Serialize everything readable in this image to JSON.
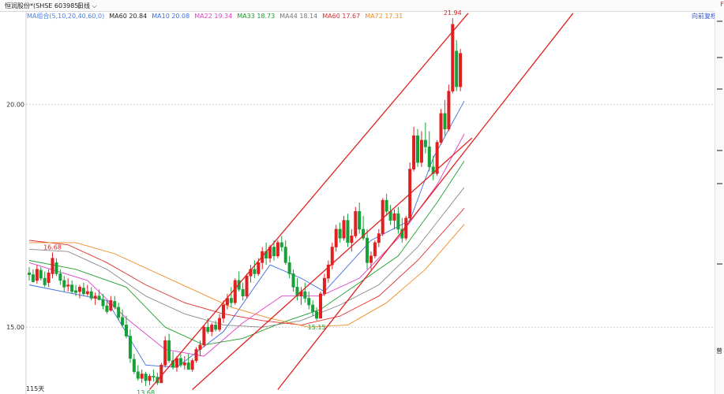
{
  "header": {
    "stock_title": "恒润股份*(SHSE 603985)",
    "period": "日线",
    "adjust": "向前复权",
    "marker": "F"
  },
  "ma_legend": [
    {
      "label": "MA组合(5,10,20,40,60,0)",
      "color": "#4a7de0"
    },
    {
      "label": "MA60 20.84",
      "color": "#222222"
    },
    {
      "label": "MA10 20.08",
      "color": "#3a6fe0"
    },
    {
      "label": "MA22 19.34",
      "color": "#e040c8"
    },
    {
      "label": "MA33 18.73",
      "color": "#20a030"
    },
    {
      "label": "MA44 18.14",
      "color": "#777777"
    },
    {
      "label": "MA60 17.67",
      "color": "#e03030"
    },
    {
      "label": "MA72 17.31",
      "color": "#f08a20"
    }
  ],
  "footer": {
    "days_label": "115天",
    "rail_button": "曾"
  },
  "chart_data": {
    "type": "candlestick",
    "ylim": [
      13.5,
      22.1
    ],
    "y_ticks": [
      15.0,
      20.0
    ],
    "y_tick_labels": [
      "15.00",
      "20.00"
    ],
    "grid": true,
    "up_color": "#e02020",
    "down_color": "#17a037",
    "annotations": [
      {
        "label": "21.94",
        "index": 109,
        "value": 21.94
      },
      {
        "label": "16.68",
        "index": 6,
        "value": 16.68
      },
      {
        "label": "13.68",
        "index": 30,
        "value": 13.68
      },
      {
        "label": "15.15",
        "index": 74,
        "value": 15.15
      }
    ],
    "trend_channel": {
      "color": "#e02020",
      "upper": {
        "start": [
          31,
          13.6
        ],
        "end": [
          113,
          22.05
        ]
      },
      "lower": {
        "start": [
          64,
          13.6
        ],
        "end": [
          140,
          22.05
        ]
      },
      "mid": {
        "start": [
          42,
          13.6
        ],
        "end": [
          114,
          19.25
        ]
      }
    },
    "ohlc": [
      [
        16.22,
        16.35,
        16.05,
        16.18
      ],
      [
        16.18,
        16.3,
        16.0,
        16.02
      ],
      [
        16.05,
        16.4,
        15.98,
        16.3
      ],
      [
        16.28,
        16.35,
        16.05,
        16.1
      ],
      [
        16.1,
        16.25,
        15.9,
        15.95
      ],
      [
        16.0,
        16.3,
        15.9,
        16.22
      ],
      [
        16.2,
        16.68,
        16.1,
        16.55
      ],
      [
        16.45,
        16.55,
        16.15,
        16.2
      ],
      [
        16.2,
        16.3,
        15.95,
        16.05
      ],
      [
        16.05,
        16.15,
        15.8,
        15.9
      ],
      [
        15.92,
        16.1,
        15.8,
        15.95
      ],
      [
        15.95,
        16.05,
        15.75,
        15.8
      ],
      [
        15.82,
        15.95,
        15.7,
        15.78
      ],
      [
        15.8,
        15.95,
        15.65,
        15.9
      ],
      [
        15.88,
        16.0,
        15.7,
        15.75
      ],
      [
        15.75,
        15.95,
        15.7,
        15.8
      ],
      [
        15.8,
        15.9,
        15.6,
        15.65
      ],
      [
        15.65,
        15.78,
        15.5,
        15.7
      ],
      [
        15.7,
        15.85,
        15.6,
        15.62
      ],
      [
        15.62,
        15.75,
        15.4,
        15.48
      ],
      [
        15.48,
        15.6,
        15.3,
        15.35
      ],
      [
        15.38,
        15.7,
        15.35,
        15.6
      ],
      [
        15.58,
        15.7,
        15.4,
        15.45
      ],
      [
        15.45,
        15.55,
        15.15,
        15.22
      ],
      [
        15.22,
        15.4,
        15.0,
        15.05
      ],
      [
        15.05,
        15.25,
        14.75,
        14.8
      ],
      [
        14.8,
        14.95,
        14.2,
        14.3
      ],
      [
        14.28,
        14.4,
        13.95,
        14.0
      ],
      [
        14.0,
        14.15,
        13.8,
        13.85
      ],
      [
        13.85,
        14.05,
        13.75,
        13.95
      ],
      [
        13.95,
        14.0,
        13.68,
        13.8
      ],
      [
        13.8,
        13.95,
        13.7,
        13.9
      ],
      [
        13.9,
        14.05,
        13.78,
        13.88
      ],
      [
        13.88,
        13.98,
        13.7,
        13.75
      ],
      [
        13.75,
        14.2,
        13.75,
        14.15
      ],
      [
        14.15,
        14.8,
        14.1,
        14.7
      ],
      [
        14.7,
        14.85,
        14.2,
        14.25
      ],
      [
        14.25,
        14.45,
        14.05,
        14.1
      ],
      [
        14.1,
        14.35,
        14.0,
        14.3
      ],
      [
        14.3,
        14.4,
        14.1,
        14.15
      ],
      [
        14.15,
        14.35,
        14.05,
        14.2
      ],
      [
        14.2,
        14.4,
        14.1,
        14.05
      ],
      [
        14.05,
        14.3,
        14.0,
        14.25
      ],
      [
        14.25,
        14.55,
        14.2,
        14.5
      ],
      [
        14.5,
        14.7,
        14.35,
        14.6
      ],
      [
        14.6,
        15.05,
        14.55,
        15.0
      ],
      [
        15.0,
        15.2,
        14.85,
        14.9
      ],
      [
        14.9,
        15.1,
        14.8,
        15.05
      ],
      [
        15.05,
        15.15,
        14.9,
        14.95
      ],
      [
        14.95,
        15.3,
        14.9,
        15.2
      ],
      [
        15.2,
        15.6,
        15.1,
        15.5
      ],
      [
        15.5,
        15.75,
        15.4,
        15.65
      ],
      [
        15.65,
        15.9,
        15.45,
        15.55
      ],
      [
        15.55,
        16.1,
        15.5,
        16.05
      ],
      [
        16.05,
        16.25,
        15.8,
        15.85
      ],
      [
        15.85,
        16.0,
        15.6,
        15.7
      ],
      [
        15.7,
        16.2,
        15.65,
        16.15
      ],
      [
        16.15,
        16.4,
        16.0,
        16.3
      ],
      [
        16.3,
        16.5,
        16.1,
        16.2
      ],
      [
        16.2,
        16.55,
        16.15,
        16.45
      ],
      [
        16.45,
        16.8,
        16.3,
        16.7
      ],
      [
        16.7,
        16.9,
        16.4,
        16.55
      ],
      [
        16.55,
        16.85,
        16.45,
        16.8
      ],
      [
        16.8,
        16.95,
        16.5,
        16.6
      ],
      [
        16.6,
        16.95,
        16.55,
        16.9
      ],
      [
        16.9,
        17.05,
        16.7,
        16.8
      ],
      [
        16.8,
        16.95,
        16.4,
        16.45
      ],
      [
        16.45,
        16.6,
        16.1,
        16.2
      ],
      [
        16.2,
        16.3,
        15.8,
        15.9
      ],
      [
        15.9,
        16.1,
        15.6,
        15.7
      ],
      [
        15.7,
        15.9,
        15.5,
        15.8
      ],
      [
        15.8,
        16.0,
        15.55,
        15.65
      ],
      [
        15.65,
        15.8,
        15.4,
        15.5
      ],
      [
        15.5,
        15.6,
        15.25,
        15.35
      ],
      [
        15.35,
        15.45,
        15.15,
        15.2
      ],
      [
        15.2,
        15.8,
        15.2,
        15.75
      ],
      [
        15.75,
        16.2,
        15.7,
        16.1
      ],
      [
        16.1,
        16.5,
        16.0,
        16.4
      ],
      [
        16.4,
        16.9,
        16.3,
        16.8
      ],
      [
        16.8,
        17.3,
        16.7,
        17.2
      ],
      [
        17.2,
        17.35,
        16.9,
        17.0
      ],
      [
        17.0,
        17.5,
        16.95,
        17.4
      ],
      [
        17.4,
        17.55,
        16.8,
        16.9
      ],
      [
        16.9,
        17.2,
        16.7,
        17.05
      ],
      [
        17.05,
        17.7,
        17.0,
        17.6
      ],
      [
        17.6,
        17.8,
        17.1,
        17.2
      ],
      [
        17.2,
        17.5,
        16.95,
        17.0
      ],
      [
        17.0,
        17.2,
        16.3,
        16.45
      ],
      [
        16.45,
        16.7,
        16.3,
        16.6
      ],
      [
        16.6,
        16.95,
        16.55,
        16.9
      ],
      [
        16.9,
        17.2,
        16.8,
        17.1
      ],
      [
        17.1,
        17.9,
        17.05,
        17.85
      ],
      [
        17.85,
        18.0,
        17.5,
        17.6
      ],
      [
        17.6,
        17.75,
        17.3,
        17.4
      ],
      [
        17.4,
        17.65,
        17.2,
        17.55
      ],
      [
        17.55,
        17.7,
        17.1,
        17.2
      ],
      [
        17.2,
        17.45,
        16.9,
        17.0
      ],
      [
        17.0,
        17.5,
        16.95,
        17.45
      ],
      [
        17.45,
        18.7,
        17.4,
        18.55
      ],
      [
        18.55,
        19.5,
        18.5,
        19.3
      ],
      [
        19.3,
        19.45,
        18.6,
        18.7
      ],
      [
        18.7,
        19.4,
        18.6,
        19.2
      ],
      [
        19.2,
        19.6,
        18.9,
        19.05
      ],
      [
        19.05,
        19.4,
        18.5,
        18.6
      ],
      [
        18.6,
        18.85,
        18.3,
        18.45
      ],
      [
        18.45,
        19.2,
        18.4,
        19.15
      ],
      [
        19.15,
        19.9,
        19.1,
        19.8
      ],
      [
        19.8,
        20.1,
        19.3,
        19.45
      ],
      [
        19.45,
        20.45,
        19.4,
        20.3
      ],
      [
        20.3,
        21.94,
        20.25,
        21.8
      ],
      [
        21.2,
        21.45,
        20.3,
        20.4
      ],
      [
        20.4,
        21.25,
        20.3,
        21.15
      ]
    ],
    "moving_averages": [
      {
        "name": "MA10",
        "color": "#3a6fe0",
        "values": [
          [
            0,
            15.95
          ],
          [
            20,
            15.6
          ],
          [
            30,
            14.15
          ],
          [
            38,
            14.1
          ],
          [
            50,
            14.9
          ],
          [
            62,
            16.4
          ],
          [
            70,
            16.1
          ],
          [
            76,
            15.8
          ],
          [
            88,
            16.95
          ],
          [
            98,
            17.4
          ],
          [
            104,
            18.8
          ],
          [
            112,
            20.08
          ]
        ]
      },
      {
        "name": "MA22",
        "color": "#e040c8",
        "values": [
          [
            0,
            16.45
          ],
          [
            15,
            16.05
          ],
          [
            25,
            15.2
          ],
          [
            35,
            14.5
          ],
          [
            45,
            14.35
          ],
          [
            55,
            15.1
          ],
          [
            65,
            15.7
          ],
          [
            75,
            15.7
          ],
          [
            85,
            16.1
          ],
          [
            95,
            17.0
          ],
          [
            105,
            18.2
          ],
          [
            112,
            19.34
          ]
        ]
      },
      {
        "name": "MA33",
        "color": "#20a030",
        "values": [
          [
            0,
            16.5
          ],
          [
            12,
            16.3
          ],
          [
            25,
            15.9
          ],
          [
            35,
            15.0
          ],
          [
            45,
            14.6
          ],
          [
            55,
            14.75
          ],
          [
            65,
            15.1
          ],
          [
            75,
            15.4
          ],
          [
            85,
            16.0
          ],
          [
            95,
            16.6
          ],
          [
            105,
            17.8
          ],
          [
            112,
            18.73
          ]
        ]
      },
      {
        "name": "MA44",
        "color": "#888888",
        "values": [
          [
            0,
            16.75
          ],
          [
            10,
            16.7
          ],
          [
            20,
            16.3
          ],
          [
            30,
            15.7
          ],
          [
            40,
            15.3
          ],
          [
            50,
            15.05
          ],
          [
            60,
            15.0
          ],
          [
            70,
            15.15
          ],
          [
            80,
            15.5
          ],
          [
            90,
            15.95
          ],
          [
            100,
            16.8
          ],
          [
            112,
            18.14
          ]
        ]
      },
      {
        "name": "MA60",
        "color": "#e03030",
        "values": [
          [
            0,
            16.95
          ],
          [
            10,
            16.85
          ],
          [
            20,
            16.45
          ],
          [
            30,
            15.95
          ],
          [
            40,
            15.55
          ],
          [
            50,
            15.3
          ],
          [
            60,
            15.15
          ],
          [
            70,
            15.05
          ],
          [
            80,
            15.25
          ],
          [
            90,
            15.7
          ],
          [
            100,
            16.5
          ],
          [
            112,
            17.67
          ]
        ]
      },
      {
        "name": "MA72",
        "color": "#f08a20",
        "values": [
          [
            0,
            16.9
          ],
          [
            12,
            16.9
          ],
          [
            22,
            16.65
          ],
          [
            32,
            16.25
          ],
          [
            42,
            15.85
          ],
          [
            52,
            15.45
          ],
          [
            62,
            15.2
          ],
          [
            72,
            15.0
          ],
          [
            82,
            15.05
          ],
          [
            92,
            15.55
          ],
          [
            102,
            16.3
          ],
          [
            112,
            17.31
          ]
        ]
      }
    ]
  }
}
